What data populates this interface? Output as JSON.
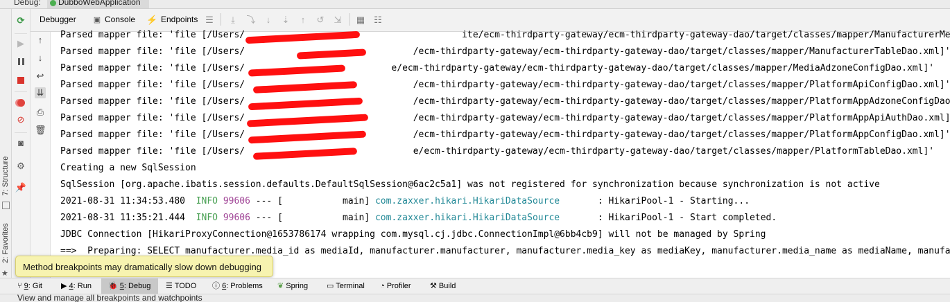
{
  "top": {
    "label": "Debug:",
    "tab": "DubboWebApplication"
  },
  "tabs": {
    "debugger": "Debugger",
    "console": "Console",
    "endpoints": "Endpoints"
  },
  "side": {
    "structure": "7: Structure",
    "favorites": "2: Favorites"
  },
  "console": {
    "mapper_lines": [
      "Parsed mapper file: 'file [/Users/                                        ite/ecm-thirdparty-gateway/ecm-thirdparty-gateway-dao/target/classes/mapper/ManufacturerMediaInfoDao.xml]'",
      "Parsed mapper file: 'file [/Users/                               /ecm-thirdparty-gateway/ecm-thirdparty-gateway-dao/target/classes/mapper/ManufacturerTableDao.xml]'",
      "Parsed mapper file: 'file [/Users/                           e/ecm-thirdparty-gateway/ecm-thirdparty-gateway-dao/target/classes/mapper/MediaAdzoneConfigDao.xml]'",
      "Parsed mapper file: 'file [/Users/                               /ecm-thirdparty-gateway/ecm-thirdparty-gateway-dao/target/classes/mapper/PlatformApiConfigDao.xml]'",
      "Parsed mapper file: 'file [/Users/                               /ecm-thirdparty-gateway/ecm-thirdparty-gateway-dao/target/classes/mapper/PlatformAppAdzoneConfigDao.xml]'",
      "Parsed mapper file: 'file [/Users/                               /ecm-thirdparty-gateway/ecm-thirdparty-gateway-dao/target/classes/mapper/PlatformAppApiAuthDao.xml]'",
      "Parsed mapper file: 'file [/Users/                               /ecm-thirdparty-gateway/ecm-thirdparty-gateway-dao/target/classes/mapper/PlatformAppConfigDao.xml]'",
      "Parsed mapper file: 'file [/Users/                               e/ecm-thirdparty-gateway/ecm-thirdparty-gateway-dao/target/classes/mapper/PlatformTableDao.xml]'"
    ],
    "creating": "Creating a new SqlSession",
    "sqlsession": "SqlSession [org.apache.ibatis.session.defaults.DefaultSqlSession@6ac2c5a1] was not registered for synchronization because synchronization is not active",
    "log1": {
      "ts": "2021-08-31 11:34:53.480",
      "level": "INFO",
      "pid": "99606",
      "sep": "--- [           main]",
      "cls": "com.zaxxer.hikari.HikariDataSource",
      "msg": ": HikariPool-1 - Starting..."
    },
    "log2": {
      "ts": "2021-08-31 11:35:21.444",
      "level": "INFO",
      "pid": "99606",
      "sep": "--- [           main]",
      "cls": "com.zaxxer.hikari.HikariDataSource",
      "msg": ": HikariPool-1 - Start completed."
    },
    "jdbc": "JDBC Connection [HikariProxyConnection@1653786174 wrapping com.mysql.cj.jdbc.ConnectionImpl@6bb4cb9] will not be managed by Spring",
    "preparing": "==>  Preparing: SELECT manufacturer.media_id as mediaId, manufacturer.manufacturer, manufacturer.media_key as mediaKey, manufacturer.media_name as mediaName, manufac"
  },
  "tooltip": "Method breakpoints may dramatically slow down debugging",
  "bottom": {
    "git_num": "9",
    "git": ": Git",
    "run_num": "4",
    "run": ": Run",
    "debug_num": "5",
    "debug": ": Debug",
    "todo": "TODO",
    "problems_num": "6",
    "problems": ": Problems",
    "spring": "Spring",
    "terminal": "Terminal",
    "profiler": "Profiler",
    "build": "Build"
  },
  "status": "View and manage all breakpoints and watchpoints",
  "colors": {
    "info": "#49a053",
    "pid": "#a04496",
    "class": "#218896",
    "tooltip_bg": "#f7f3b0",
    "redaction": "#ff1010"
  }
}
